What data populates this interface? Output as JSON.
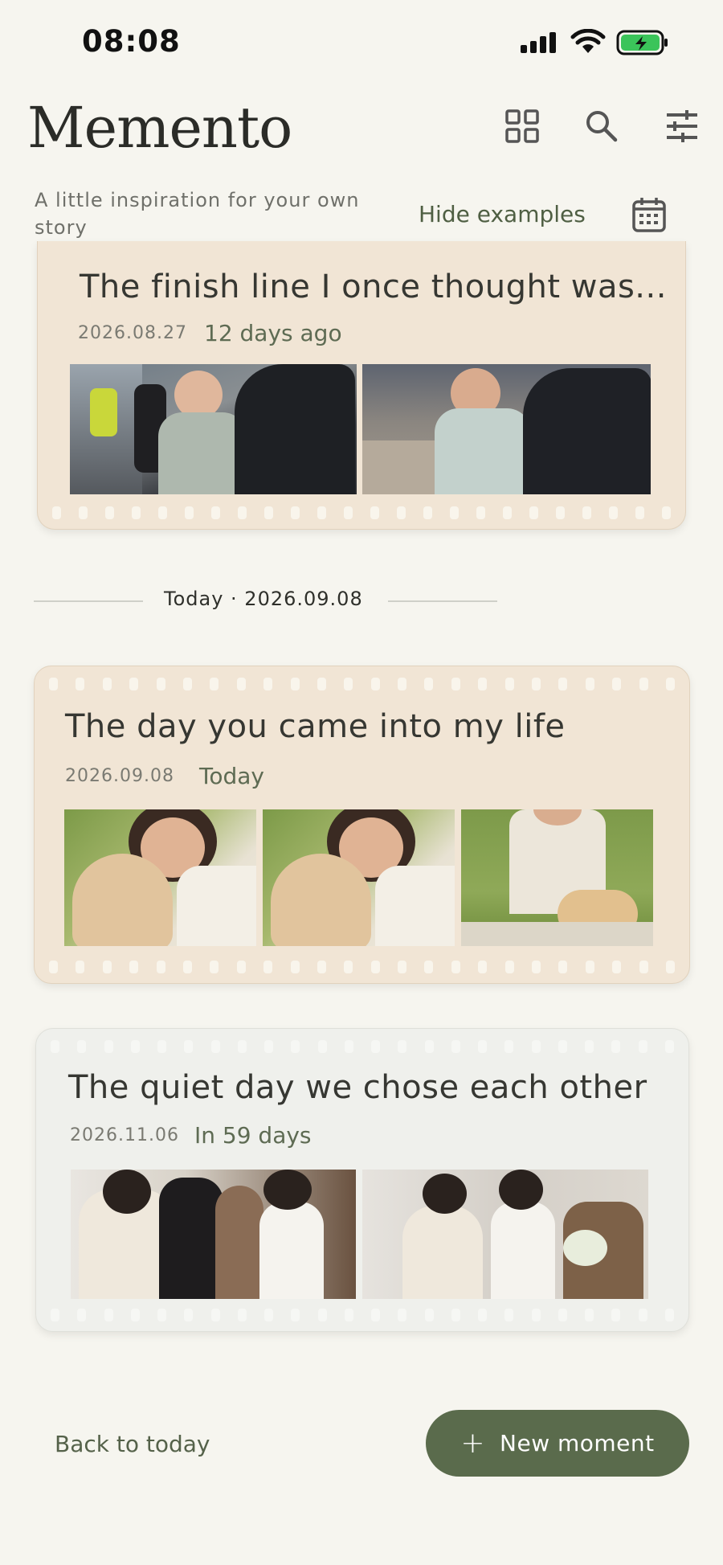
{
  "status_bar": {
    "time": "08:08"
  },
  "header": {
    "title": "Memento",
    "subtitle": "A little inspiration for your own story",
    "hide_examples_label": "Hide examples",
    "icons": [
      "grid-icon",
      "search-icon",
      "filter-sliders-icon",
      "calendar-icon"
    ]
  },
  "moments": [
    {
      "title": "The finish line I once thought was...",
      "date": "2026.08.27",
      "relative": "12 days ago"
    },
    {
      "title": "The day you came into my life",
      "date": "2026.09.08",
      "relative": "Today"
    },
    {
      "title": "The quiet day we chose each other",
      "date": "2026.11.06",
      "relative": "In 59 days"
    }
  ],
  "divider": {
    "label": "Today · 2026.09.08"
  },
  "bottom": {
    "back_label": "Back to today",
    "new_label": "New moment"
  },
  "colors": {
    "accent": "#5a6b4c",
    "card_beige": "#f1e5d5",
    "card_gray": "#eff0ec",
    "background": "#f6f5ef"
  }
}
